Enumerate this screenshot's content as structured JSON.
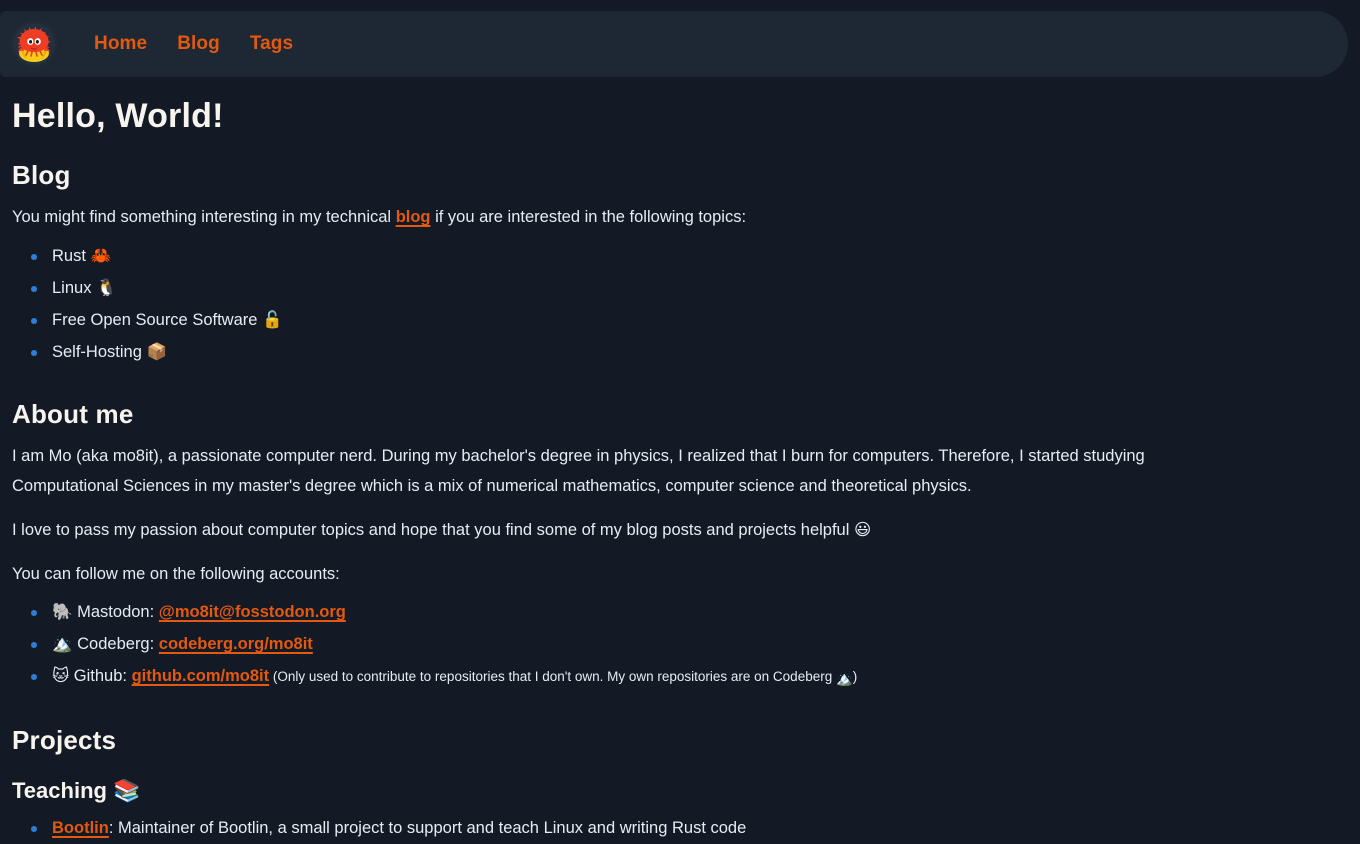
{
  "theme": {
    "page_background": "#131a26",
    "navbar_background": "#1e2734",
    "heading_color": "#f7f4ee",
    "body_text_color": "#e7ecf3",
    "link_color": "#e2590f",
    "bullet_color": "#2b80d6"
  },
  "navbar": {
    "logo_name": "ferris-crab-logo",
    "links": [
      {
        "label": "Home"
      },
      {
        "label": "Blog"
      },
      {
        "label": "Tags"
      }
    ]
  },
  "page": {
    "title": "Hello, World!"
  },
  "blog_section": {
    "heading": "Blog",
    "intro_before_link": "You might find something interesting in my technical ",
    "intro_link": "blog",
    "intro_after_link": " if you are interested in the following topics:",
    "topics": [
      {
        "label": "Rust",
        "emoji": "🦀",
        "emoji_name": "crab-emoji"
      },
      {
        "label": "Linux",
        "emoji": "🐧",
        "emoji_name": "penguin-emoji"
      },
      {
        "label": "Free Open Source Software",
        "emoji": "🔓",
        "emoji_name": "unlocked-padlock-emoji"
      },
      {
        "label": "Self-Hosting",
        "emoji": "📦",
        "emoji_name": "package-emoji"
      }
    ]
  },
  "about_section": {
    "heading": "About me",
    "paragraph_1": "I am Mo (aka mo8it), a passionate computer nerd. During my bachelor's degree in physics, I realized that I burn for computers. Therefore, I started studying Computational Sciences in my master's degree which is a mix of numerical mathematics, computer science and theoretical physics.",
    "paragraph_2_text": "I love to pass my passion about computer topics and hope that you find some of my blog posts and projects helpful ",
    "paragraph_2_emoji": "😃",
    "paragraph_3": "You can follow me on the following accounts:",
    "accounts": [
      {
        "emoji": "🐘",
        "emoji_name": "elephant-emoji",
        "label": "Mastodon: ",
        "link": "@mo8it@fosstodon.org",
        "note_before": "",
        "note_after": ""
      },
      {
        "emoji": "🏔️",
        "emoji_name": "snow-mountain-emoji",
        "label": "Codeberg: ",
        "link": "codeberg.org/mo8it",
        "note_before": "",
        "note_after": ""
      },
      {
        "emoji": "🐱",
        "emoji_name": "cat-face-emoji",
        "label": "Github: ",
        "link": "github.com/mo8it",
        "note_before": " (Only used to contribute to repositories that I don't own. My own repositories are on Codeberg ",
        "note_after": ")"
      }
    ],
    "account_note_emoji": "🏔️"
  },
  "projects_section": {
    "heading": "Projects",
    "teaching_heading": "Teaching",
    "teaching_emoji": "📚",
    "teaching_emoji_name": "books-emoji",
    "items": [
      {
        "link": "Bootlin",
        "text": ": Maintainer of Bootlin, a small project to support and teach Linux and writing Rust code"
      }
    ]
  }
}
